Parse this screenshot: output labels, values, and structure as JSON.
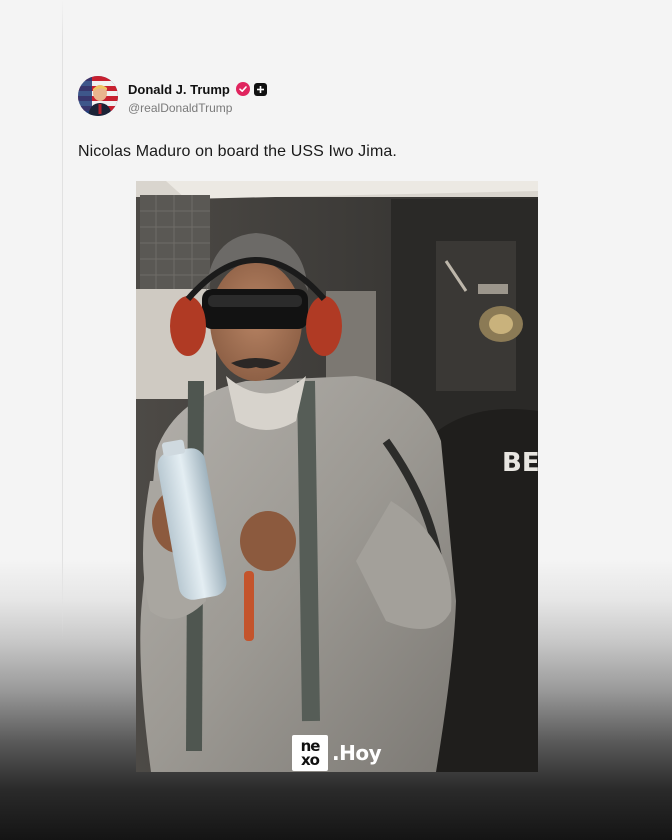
{
  "post": {
    "author": {
      "display_name": "Donald J. Trump",
      "handle": "@realDonaldTrump",
      "verified_icon": "verified-badge-icon",
      "badge_icon": "plus-badge-icon"
    },
    "text": "Nicolas Maduro on board the USS Iwo Jima.",
    "media": {
      "type": "photo",
      "visible_text": "BEA"
    }
  },
  "watermark": {
    "logo_top": "ne",
    "logo_bottom": "xo",
    "suffix": ".Hoy"
  },
  "colors": {
    "verified": "#e0245e",
    "text": "#1a1a1a",
    "handle": "#7a7a7a"
  }
}
